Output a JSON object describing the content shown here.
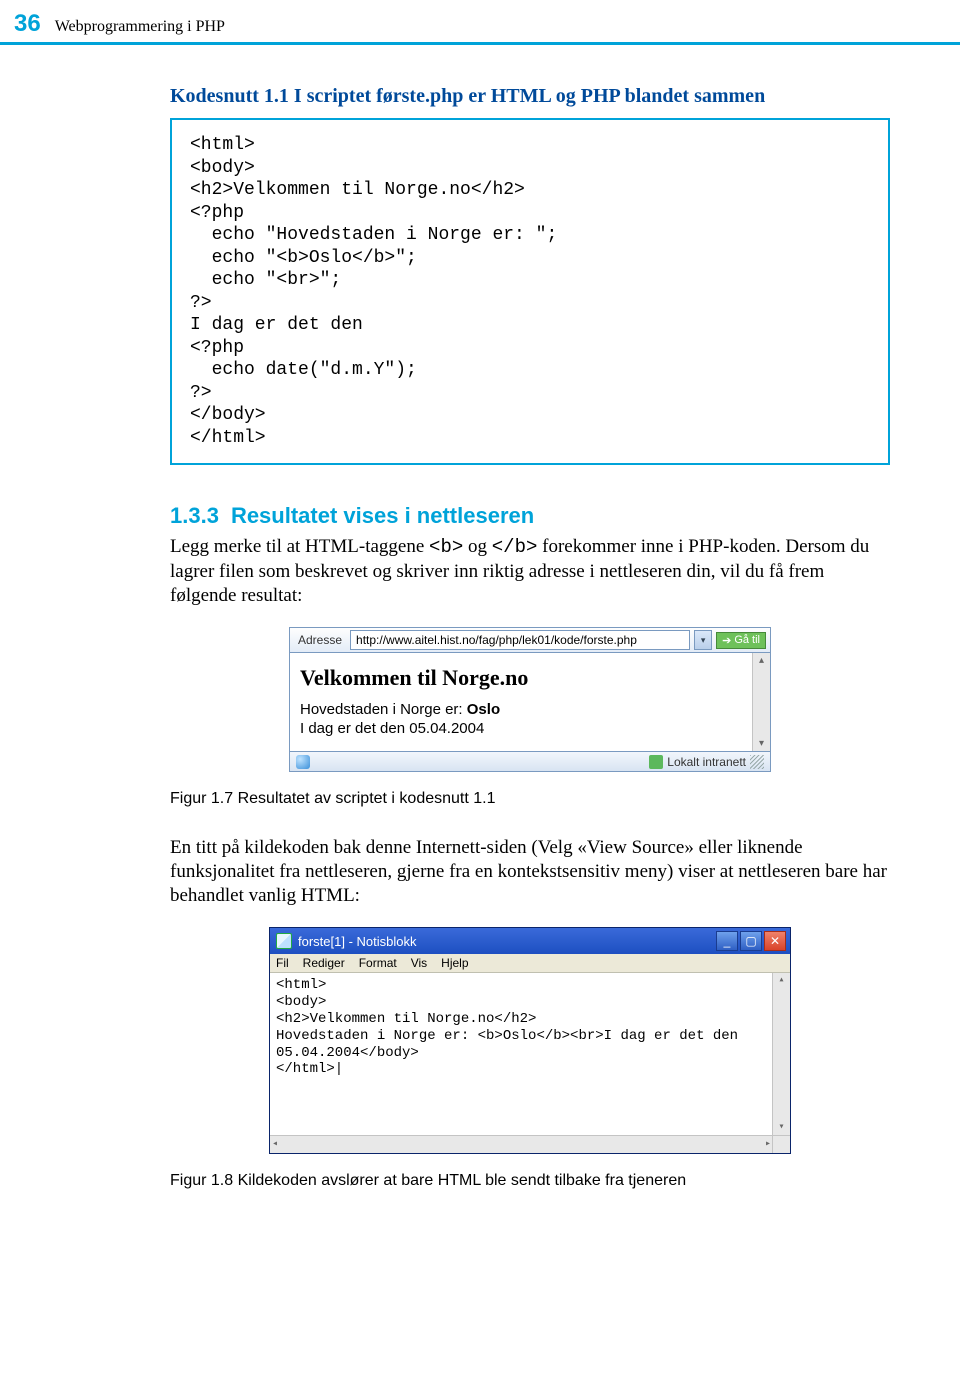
{
  "header": {
    "page_number": "36",
    "running_title": "Webprogrammering i PHP"
  },
  "kodesnutt": {
    "heading": "Kodesnutt 1.1 I scriptet første.php er HTML og PHP blandet sammen",
    "code": "<html>\n<body>\n<h2>Velkommen til Norge.no</h2>\n<?php\n  echo \"Hovedstaden i Norge er: \";\n  echo \"<b>Oslo</b>\";\n  echo \"<br>\";\n?>\nI dag er det den\n<?php\n  echo date(\"d.m.Y\");\n?>\n</body>\n</html>"
  },
  "section": {
    "number": "1.3.3",
    "title": "Resultatet vises i nettleseren",
    "para1_a": "Legg merke til at HTML-taggene ",
    "tag_open": "<b>",
    "para1_b": " og ",
    "tag_close": "</b>",
    "para1_c": " forekommer inne i PHP-koden. Dersom du lagrer filen som beskrevet og skriver inn riktig adresse i nettleseren din, vil du få frem følgende resultat:"
  },
  "browser": {
    "addr_label": "Adresse",
    "url": "http://www.aitel.hist.no/fag/php/lek01/kode/forste.php",
    "go_label": "Gå til",
    "h2": "Velkommen til Norge.no",
    "line1_a": "Hovedstaden i Norge er: ",
    "line1_b": "Oslo",
    "line2": "I dag er det den 05.04.2004",
    "status_right": "Lokalt intranett"
  },
  "fig1_caption": "Figur 1.7  Resultatet av scriptet i kodesnutt 1.1",
  "para2": "En titt på kildekoden bak denne Internett-siden (Velg «View Source» eller liknende funksjonalitet fra nettleseren, gjerne fra en kontekstsensitiv meny) viser at nettleseren bare har behandlet vanlig HTML:",
  "notepad": {
    "title": "forste[1] - Notisblokk",
    "menu": [
      "Fil",
      "Rediger",
      "Format",
      "Vis",
      "Hjelp"
    ],
    "body": "<html>\n<body>\n<h2>Velkommen til Norge.no</h2>\nHovedstaden i Norge er: <b>Oslo</b><br>I dag er det den\n05.04.2004</body>\n</html>|"
  },
  "fig2_caption": "Figur 1.8  Kildekoden avslører at bare HTML ble sendt tilbake fra tjeneren"
}
